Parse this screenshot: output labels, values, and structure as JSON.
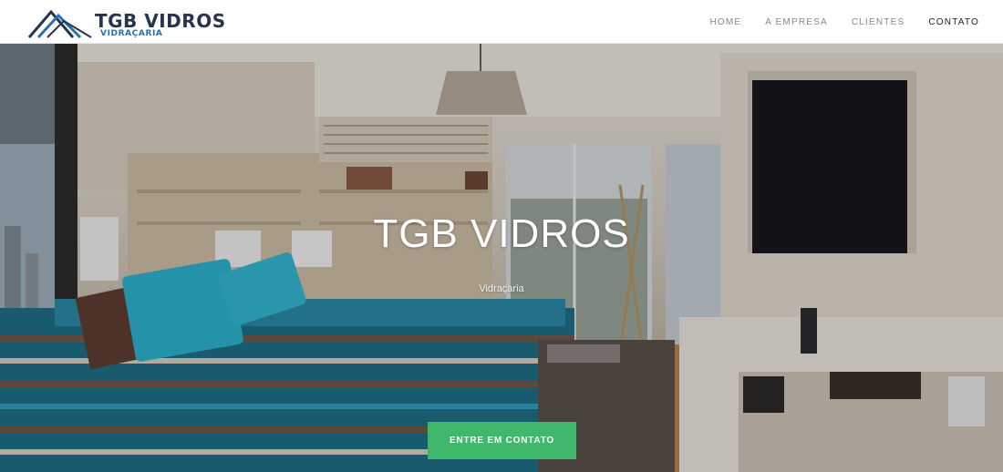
{
  "brand": {
    "name": "TGB VIDROS",
    "tagline": "VIDRAÇARIA",
    "color_primary": "#26344e",
    "color_accent": "#2a6fb0"
  },
  "nav": {
    "items": [
      {
        "label": "HOME",
        "active": false
      },
      {
        "label": "A EMPRESA",
        "active": false
      },
      {
        "label": "CLIENTES",
        "active": false
      },
      {
        "label": "CONTATO",
        "active": true
      }
    ]
  },
  "hero": {
    "title": "TGB VIDROS",
    "subtitle": "Vidraçaria",
    "cta_label": "ENTRE EM CONTATO",
    "cta_color": "#3fb86b",
    "background": "bedroom-interior-photo"
  }
}
